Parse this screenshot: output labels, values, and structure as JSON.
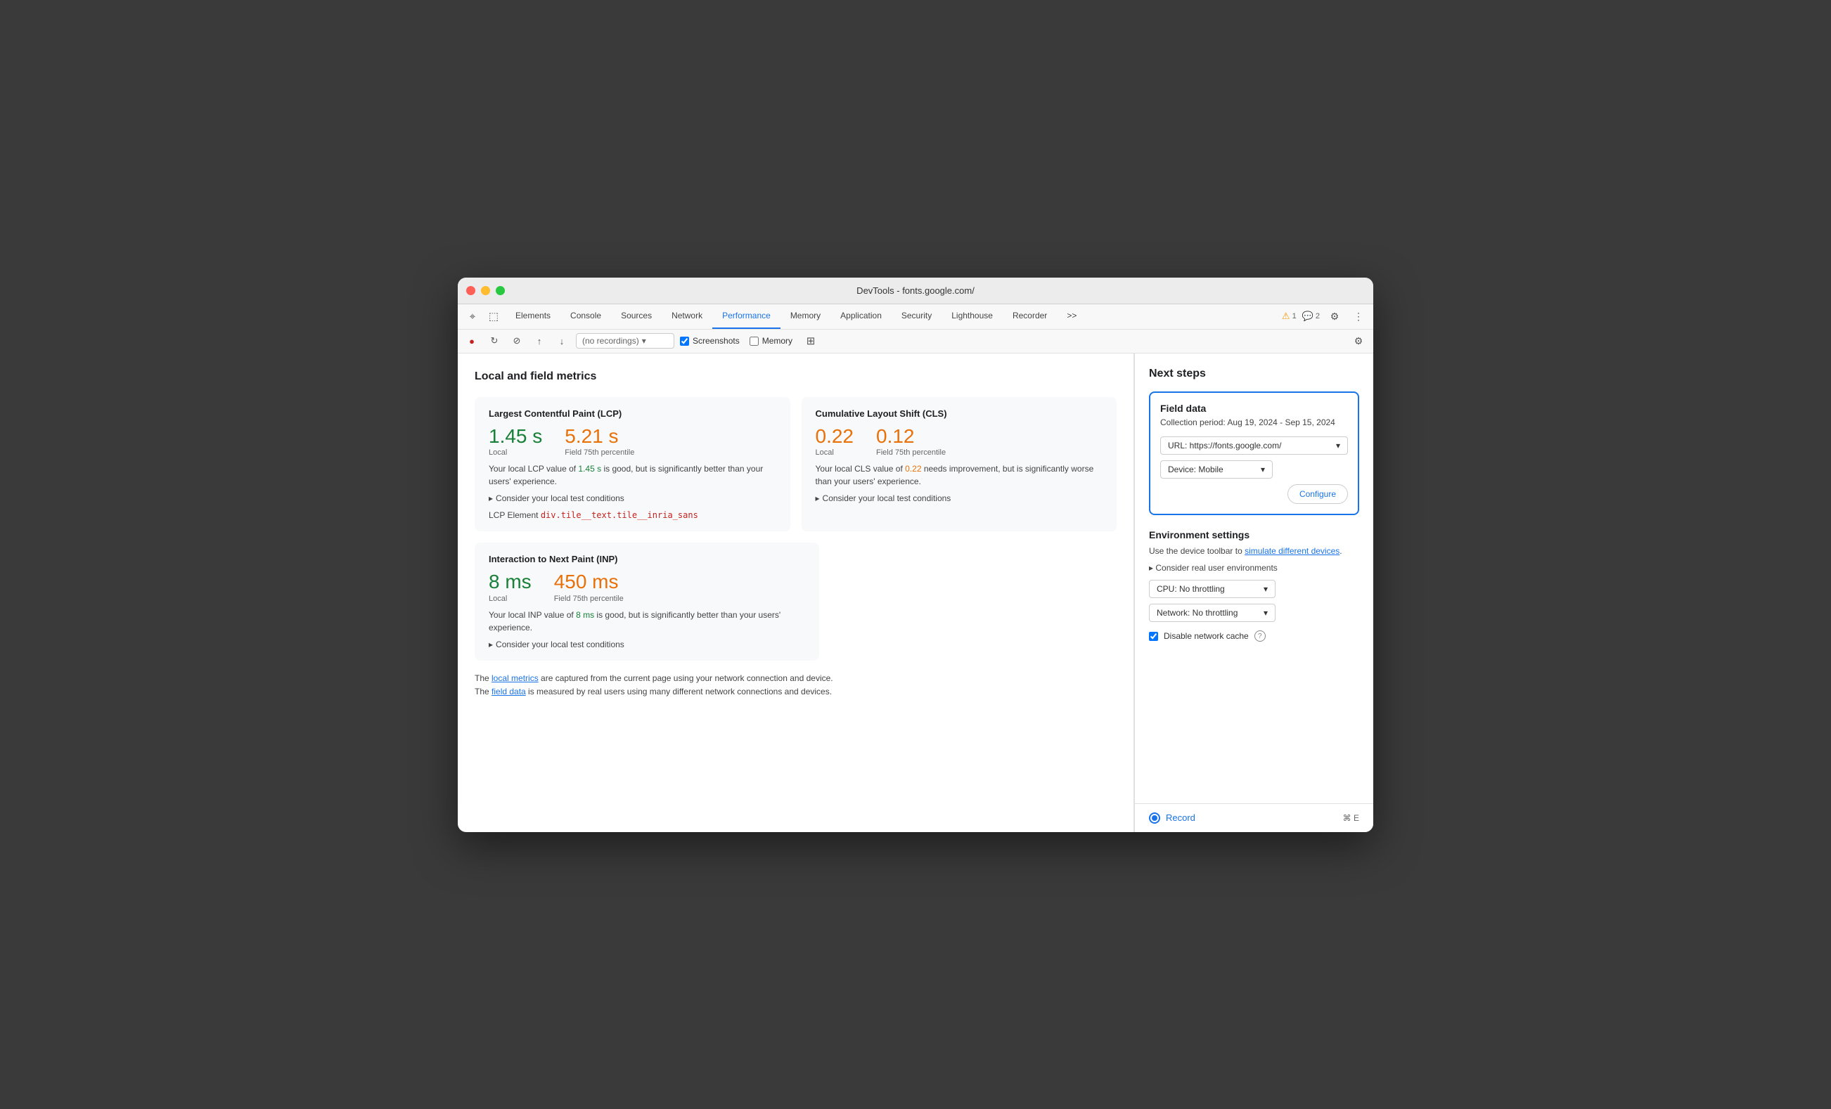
{
  "window": {
    "title": "DevTools - fonts.google.com/"
  },
  "toolbar": {
    "tabs": [
      {
        "id": "elements",
        "label": "Elements",
        "active": false
      },
      {
        "id": "console",
        "label": "Console",
        "active": false
      },
      {
        "id": "sources",
        "label": "Sources",
        "active": false
      },
      {
        "id": "network",
        "label": "Network",
        "active": false
      },
      {
        "id": "performance",
        "label": "Performance",
        "active": true
      },
      {
        "id": "memory",
        "label": "Memory",
        "active": false
      },
      {
        "id": "application",
        "label": "Application",
        "active": false
      },
      {
        "id": "security",
        "label": "Security",
        "active": false
      },
      {
        "id": "lighthouse",
        "label": "Lighthouse",
        "active": false
      },
      {
        "id": "recorder",
        "label": "Recorder",
        "active": false
      },
      {
        "id": "more",
        "label": ">>",
        "active": false
      }
    ],
    "warnings": "1",
    "messages": "2"
  },
  "subtoolbar": {
    "recording_placeholder": "(no recordings)",
    "screenshots_label": "Screenshots",
    "screenshots_checked": true,
    "memory_label": "Memory",
    "memory_checked": false
  },
  "main": {
    "section_title": "Local and field metrics",
    "lcp_card": {
      "title": "Largest Contentful Paint (LCP)",
      "local_value": "1.45 s",
      "local_label": "Local",
      "field_value": "5.21 s",
      "field_label": "Field 75th percentile",
      "description_part1": "Your local LCP value of ",
      "description_value": "1.45 s",
      "description_part2": " is good, but is significantly better than your users' experience.",
      "expand_text": "Consider your local test conditions",
      "lcp_element_label": "LCP Element",
      "lcp_element_value": "div.tile__text.tile__inria_sans"
    },
    "cls_card": {
      "title": "Cumulative Layout Shift (CLS)",
      "local_value": "0.22",
      "local_label": "Local",
      "field_value": "0.12",
      "field_label": "Field 75th percentile",
      "description_part1": "Your local CLS value of ",
      "description_value": "0.22",
      "description_part2": " needs improvement, but is significantly worse than your users' experience.",
      "expand_text": "Consider your local test conditions"
    },
    "inp_card": {
      "title": "Interaction to Next Paint (INP)",
      "local_value": "8 ms",
      "local_label": "Local",
      "field_value": "450 ms",
      "field_label": "Field 75th percentile",
      "description_part1": "Your local INP value of ",
      "description_value": "8 ms",
      "description_part2": " is good, but is significantly better than your users' experience.",
      "expand_text": "Consider your local test conditions"
    },
    "footer": {
      "text1": "The ",
      "link1": "local metrics",
      "text2": " are captured from the current page using your network connection and device.",
      "text3": "The ",
      "link2": "field data",
      "text4": " is measured by real users using many different network connections and devices."
    }
  },
  "right_panel": {
    "title": "Next steps",
    "field_data": {
      "title": "Field data",
      "period": "Collection period: Aug 19, 2024 - Sep 15, 2024",
      "url_label": "URL: https://fonts.google.com/",
      "device_label": "Device: Mobile",
      "configure_label": "Configure"
    },
    "env_settings": {
      "title": "Environment settings",
      "desc_part1": "Use the device toolbar to ",
      "desc_link": "simulate different devices",
      "desc_part2": ".",
      "expand_text": "Consider real user environments",
      "cpu_label": "CPU: No throttling",
      "network_label": "Network: No throttling",
      "disable_cache_label": "Disable network cache"
    },
    "record": {
      "label": "Record",
      "shortcut": "⌘ E"
    }
  },
  "icons": {
    "cursor": "⌖",
    "inspector": "⬚",
    "record_start": "●",
    "refresh": "↻",
    "clear": "⊘",
    "upload": "↑",
    "download": "↓",
    "settings": "⚙",
    "more_vert": "⋮",
    "chevron": "▾",
    "triangle": "▸",
    "warning": "⚠",
    "chat": "💬"
  }
}
